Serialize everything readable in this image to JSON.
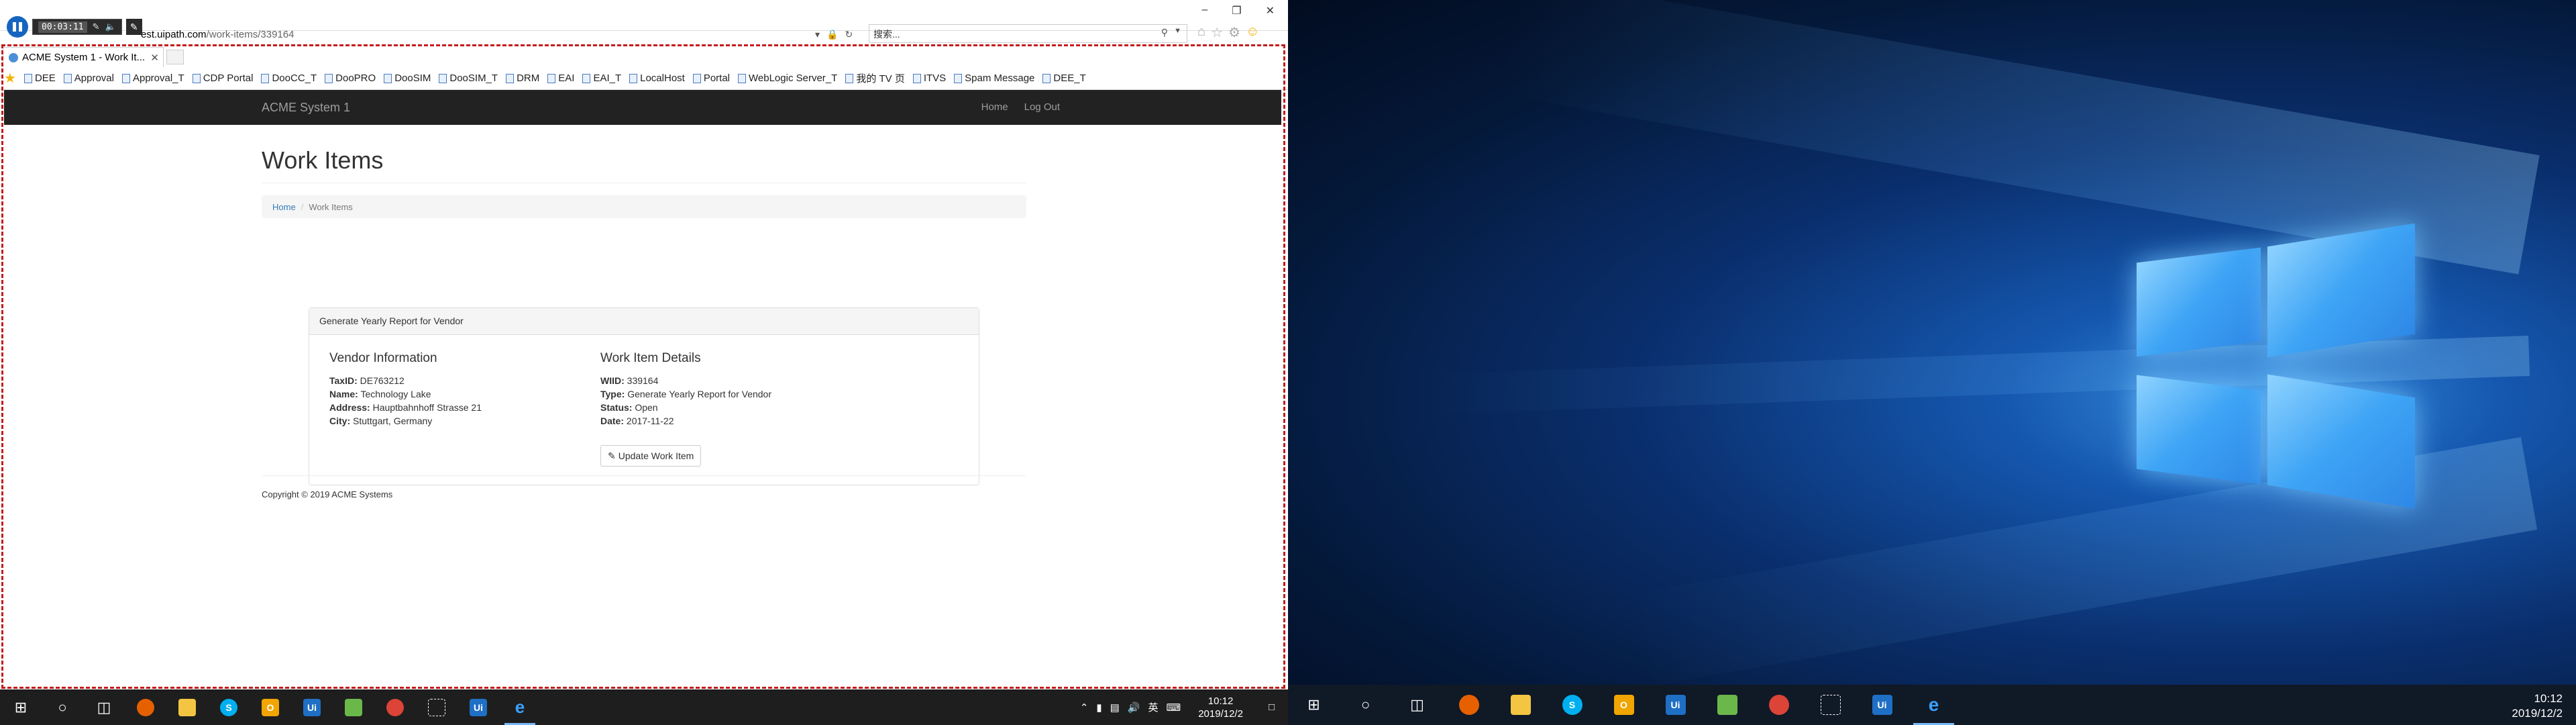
{
  "recorder": {
    "time": "00:03:11"
  },
  "browser": {
    "url_host_prefix": "est.uipath.com",
    "url_path": "/work-items/339164",
    "search_placeholder": "搜索...",
    "tab_title": "ACME System 1 - Work It...",
    "favorites": [
      "DEE",
      "Approval",
      "Approval_T",
      "CDP Portal",
      "DooCC_T",
      "DooPRO",
      "DooSIM",
      "DooSIM_T",
      "DRM",
      "EAI",
      "EAI_T",
      "LocalHost",
      "Portal",
      "WebLogic Server_T",
      "我的 TV 页",
      "ITVS",
      "Spam Message",
      "DEE_T"
    ]
  },
  "page": {
    "brand": "ACME System 1",
    "nav": {
      "home": "Home",
      "logout": "Log Out"
    },
    "title": "Work Items",
    "breadcrumb": {
      "home": "Home",
      "current": "Work Items"
    },
    "panel": {
      "heading": "Generate Yearly Report for Vendor",
      "vendor": {
        "title": "Vendor Information",
        "taxid_label": "TaxID:",
        "taxid": "DE763212",
        "name_label": "Name:",
        "name": "Technology Lake",
        "address_label": "Address:",
        "address": "Hauptbahnhoff Strasse 21",
        "city_label": "City:",
        "city": "Stuttgart, Germany"
      },
      "details": {
        "title": "Work Item Details",
        "wiid_label": "WIID:",
        "wiid": "339164",
        "type_label": "Type:",
        "type": "Generate Yearly Report for Vendor",
        "status_label": "Status:",
        "status": "Open",
        "date_label": "Date:",
        "date": "2017-11-22"
      },
      "button": "Update Work Item"
    },
    "footer": "Copyright © 2019 ACME Systems"
  },
  "taskbar_left": {
    "time": "10:12",
    "date": "2019/12/2",
    "ime": "英"
  },
  "taskbar_right": {
    "time": "10:12",
    "date": "2019/12/2"
  }
}
